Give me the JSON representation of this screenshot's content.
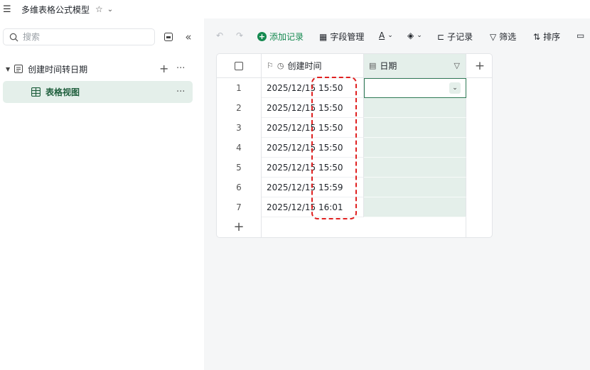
{
  "topbar": {
    "title": "多维表格公式模型"
  },
  "sidebar": {
    "search_placeholder": "搜索",
    "tree": {
      "parent_label": "创建时间转日期",
      "child_label": "表格视图"
    }
  },
  "toolbar": {
    "add_record": "添加记录",
    "field_manage": "字段管理",
    "sub_record": "子记录",
    "filter": "筛选",
    "sort": "排序"
  },
  "table": {
    "columns": {
      "created_time": "创建时间",
      "date": "日期"
    },
    "rows": [
      {
        "idx": "1",
        "time": "2025/12/15 15:50"
      },
      {
        "idx": "2",
        "time": "2025/12/15 15:50"
      },
      {
        "idx": "3",
        "time": "2025/12/15 15:50"
      },
      {
        "idx": "4",
        "time": "2025/12/15 15:50"
      },
      {
        "idx": "5",
        "time": "2025/12/15 15:50"
      },
      {
        "idx": "6",
        "time": "2025/12/15 15:59"
      },
      {
        "idx": "7",
        "time": "2025/12/15 16:01"
      }
    ]
  },
  "colors": {
    "accent": "#168a51",
    "highlight": "#e02020",
    "selected_bg": "#e4efea"
  }
}
